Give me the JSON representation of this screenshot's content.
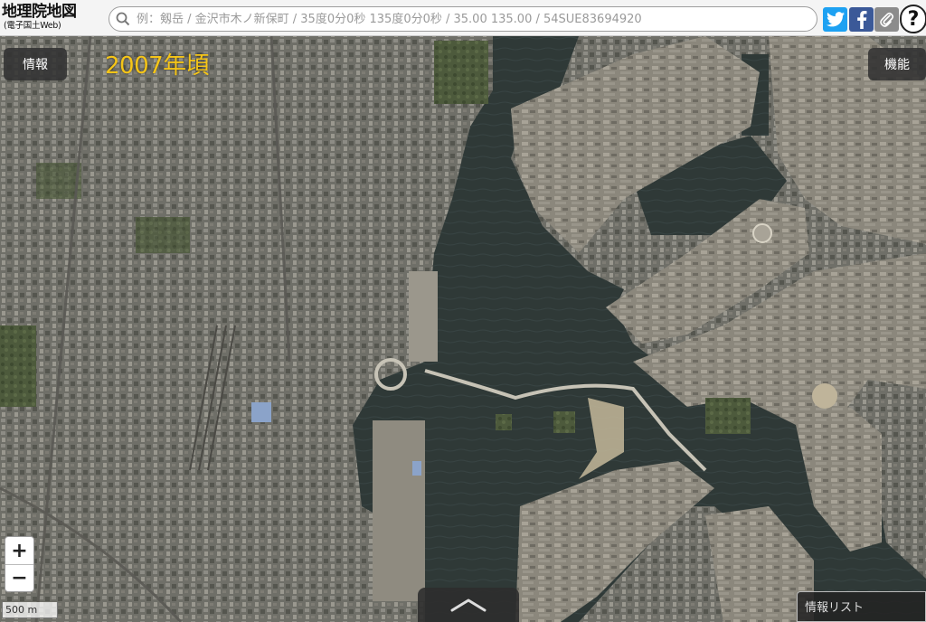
{
  "header": {
    "logo_title": "地理院地図",
    "logo_subtitle": "(電子国土Web)"
  },
  "search": {
    "placeholder": "例：剱岳 / 金沢市木ノ新保町 / 35度0分0秒 135度0分0秒 / 35.00 135.00 / 54SUE83694920",
    "icon": "search-icon"
  },
  "share_buttons": [
    {
      "name": "twitter",
      "icon": "twitter-icon",
      "color": "#1da1f2"
    },
    {
      "name": "facebook",
      "icon": "facebook-icon",
      "color": "#3b5998"
    },
    {
      "name": "link",
      "icon": "paperclip-icon",
      "color": "#8c8c8c"
    }
  ],
  "help_label": "?",
  "controls": {
    "info_label": "情報",
    "function_label": "機能",
    "info_list_label": "情報リスト"
  },
  "map": {
    "layer_year_label": "2007年頃",
    "scale_label": "500 m",
    "zoom_in_label": "+",
    "zoom_out_label": "−",
    "year_label_color": "#f5c518",
    "water_color": "#2f3937"
  }
}
